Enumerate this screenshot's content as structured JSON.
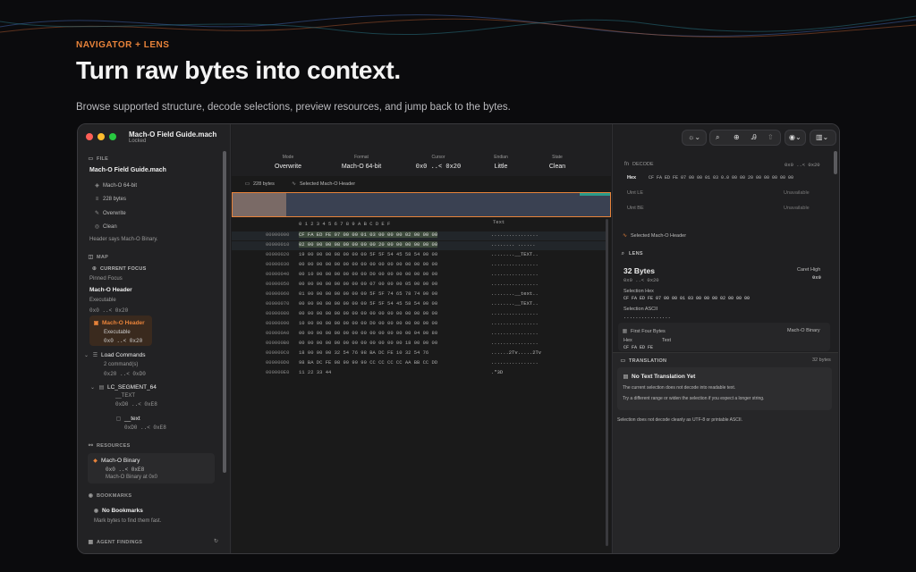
{
  "hero": {
    "eyebrow": "NAVIGATOR + LENS",
    "headline": "Turn raw bytes into context.",
    "subline": "Browse supported structure, decode selections, preview resources, and jump back to the bytes."
  },
  "window": {
    "doc_title": "Mach-O Field Guide.mach",
    "doc_sub": "Locked"
  },
  "sidebar": {
    "file_section": "FILE",
    "file_name": "Mach-O Field Guide.mach",
    "file_props": [
      "Mach-O 64-bit",
      "228 bytes",
      "Overwrite",
      "Clean"
    ],
    "file_note": "Header says Mach-O Binary.",
    "map_section": "MAP",
    "current_focus": "CURRENT FOCUS",
    "pinned_focus": "Pinned Focus",
    "focus_name": "Mach-O Header",
    "focus_kind": "Executable",
    "focus_range": "0x0 ..< 0x20",
    "card_name": "Mach-O Header",
    "card_kind": "Executable",
    "card_range": "0x0 ..< 0x20",
    "load_commands": "Load Commands",
    "load_count": "2 command(s)",
    "load_range": "0x20 ..< 0xD0",
    "segment": "LC_SEGMENT_64",
    "segment_sub": "__TEXT",
    "segment_range": "0xD0 ..< 0xE8",
    "section": "__text",
    "section_range": "0xD0 ..< 0xE8",
    "resources_section": "RESOURCES",
    "res_name": "Mach-O Binary",
    "res_range": "0x0 ..< 0xE8",
    "res_note": "Mach-O Binary at 0x0",
    "bookmarks_section": "BOOKMARKS",
    "no_bookmarks": "No Bookmarks",
    "bookmarks_note": "Mark bytes to find them fast.",
    "agent_section": "AGENT FINDINGS"
  },
  "toolbar": {
    "items": [
      {
        "label": "Mode",
        "value": "Overwrite"
      },
      {
        "label": "Format",
        "value": "Mach-O 64-bit"
      },
      {
        "label": "Cursor",
        "value": "0x0 ..< 0x20"
      },
      {
        "label": "Endian",
        "value": "Little"
      },
      {
        "label": "State",
        "value": "Clean"
      }
    ]
  },
  "infobar": {
    "size": "228 bytes",
    "selected": "Selected Mach-O Header"
  },
  "hex": {
    "columns": [
      "0",
      "1",
      "2",
      "3",
      "4",
      "5",
      "6",
      "7",
      "8",
      "9",
      "A",
      "B",
      "C",
      "D",
      "E",
      "F"
    ],
    "text_header": "Text",
    "rows": [
      {
        "off": "00000000",
        "bytes": "CF FA ED FE 07 00 00 01 03 00 00 00 02 00 00 00",
        "ascii": "................"
      },
      {
        "off": "00000010",
        "bytes": "02 00 00 00 98 00 00 00 00 20 00 00 00 00 00 00",
        "ascii": "........ ......"
      },
      {
        "off": "00000020",
        "bytes": "19 00 00 00 98 00 00 00 5F 5F 54 45 58 54 00 00",
        "ascii": "........__TEXT.."
      },
      {
        "off": "00000030",
        "bytes": "00 00 00 00 00 00 00 00 00 00 00 00 00 00 00 00",
        "ascii": "................"
      },
      {
        "off": "00000040",
        "bytes": "00 10 00 00 00 00 00 00 D0 00 00 00 00 00 00 00",
        "ascii": "................"
      },
      {
        "off": "00000050",
        "bytes": "00 00 00 00 00 00 00 00 07 00 00 00 05 00 00 00",
        "ascii": "................"
      },
      {
        "off": "00000060",
        "bytes": "01 00 00 00 00 00 00 00 5F 5F 74 65 78 74 00 00",
        "ascii": "........__text.."
      },
      {
        "off": "00000070",
        "bytes": "00 00 00 00 00 00 00 00 5F 5F 54 45 58 54 00 00",
        "ascii": "........__TEXT.."
      },
      {
        "off": "00000080",
        "bytes": "00 00 00 00 00 00 00 00 00 00 00 00 00 00 00 00",
        "ascii": "................"
      },
      {
        "off": "00000090",
        "bytes": "10 00 00 00 00 00 00 00 D0 00 00 00 00 00 00 00",
        "ascii": "................"
      },
      {
        "off": "000000A0",
        "bytes": "00 00 00 00 00 00 00 00 00 00 00 00 00 04 00 80",
        "ascii": "................"
      },
      {
        "off": "000000B0",
        "bytes": "00 00 00 00 00 00 00 00 00 00 00 00 18 00 00 00",
        "ascii": "................"
      },
      {
        "off": "000000C0",
        "bytes": "18 00 00 00 32 54 76 98 BA DC FE 10 32 54 76",
        "ascii": "......2Tv.....2Tv"
      },
      {
        "off": "000000D0",
        "bytes": "98 BA DC FE 98 90 90 90 CC CC CC CC AA BB CC DD",
        "ascii": "................"
      },
      {
        "off": "000000E0",
        "bytes": "11 22 33 44",
        "ascii": ".\"3D"
      }
    ]
  },
  "inspector": {
    "decode_label": "DECODE",
    "decode_range": "0x0 ..< 0x20",
    "hex_label": "Hex",
    "hex_value": "CF FA ED FE 07 00 00 01 03 0.0 00 00 20 00 00 00 00 00",
    "uint_le": "Uint LE",
    "uint_be": "Uint BE",
    "unavailable": "Unavailable",
    "selected": "Selected Mach-O Header",
    "lens_label": "LENS",
    "size": "32 Bytes",
    "range": "0x0 ..< 0x20",
    "caret": "Caret High",
    "caret_val": "0x0",
    "selection_hex_label": "Selection Hex",
    "selection_hex": "CF FA ED FE 07 00 00 01 03 00 00 00 02 00 00 00",
    "selection_ascii_label": "Selection ASCII",
    "selection_ascii": "................",
    "first_four": "First Four Bytes",
    "binary_tag": "Mach-O Binary",
    "hex_col": "Hex",
    "text_col": "Text",
    "first_four_val": "CF FA ED FE",
    "translation_label": "TRANSLATION",
    "translation_size": "32 bytes",
    "no_translation": "No Text Translation Yet",
    "no_translation_1": "The current selection does not decode into readable text.",
    "no_translation_2": "Try a different range or widen the selection if you expect a longer string.",
    "decode_note": "Selection does not decode cleanly as UTF-8 or printable ASCII."
  },
  "colors": {
    "accent": "#e8833a",
    "bg": "#0b0b0d",
    "panel": "#1c1c1e"
  }
}
